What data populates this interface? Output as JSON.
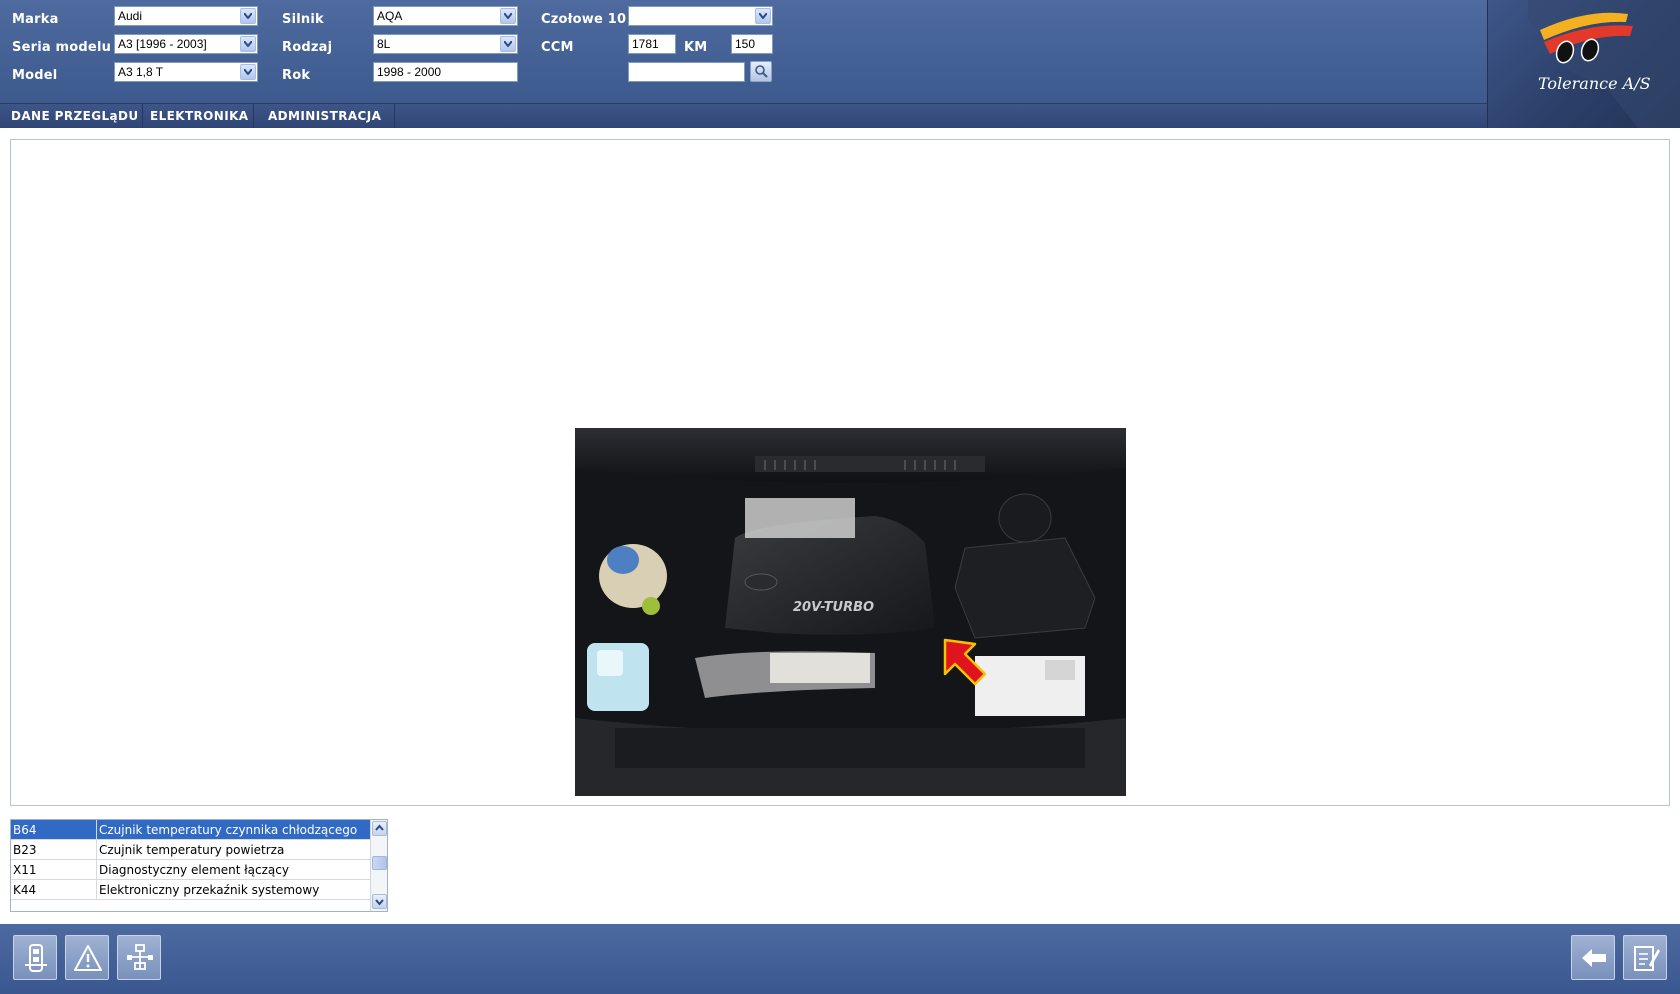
{
  "header": {
    "col1": {
      "make_label": "Marka",
      "make_value": "Audi",
      "series_label": "Seria modelu",
      "series_value": "A3 [1996 - 2003]",
      "model_label": "Model",
      "model_value": "A3 1,8 T"
    },
    "col2": {
      "engine_label": "Silnik",
      "engine_value": "AQA",
      "type_label": "Rodzaj",
      "type_value": "8L",
      "year_label": "Rok",
      "year_value": "1998 - 2000"
    },
    "col3": {
      "top10_label": "Czołowe 10",
      "top10_value": "",
      "ccm_label": "CCM",
      "ccm_value": "1781",
      "km_label": "KM",
      "km_value": "150",
      "search_value": ""
    },
    "logo_text": "Tolerance A/S"
  },
  "menu": {
    "items": [
      "DANE PRZEGLąDU",
      "ELEKTRONIKA",
      "ADMINISTRACJA"
    ]
  },
  "components": {
    "rows": [
      {
        "code": "B64",
        "name": "Czujnik temperatury czynnika chłodzącego"
      },
      {
        "code": "B23",
        "name": "Czujnik temperatury powietrza"
      },
      {
        "code": "X11",
        "name": "Diagnostyczny element łączący"
      },
      {
        "code": "K44",
        "name": "Elektroniczny przekaźnik systemowy"
      }
    ],
    "selected_index": 0
  },
  "photo": {
    "engine_cover_text": "20V-TURBO"
  },
  "colors": {
    "header_bg": "#4e6a9e",
    "menu_bg": "#3e5588",
    "selection": "#316ac5",
    "arrow_marker": "#e0141e"
  },
  "footer": {
    "left_icons": [
      "vehicle-info-icon",
      "warning-icon",
      "wiring-diagram-icon"
    ],
    "right_icons": [
      "back-arrow-icon",
      "edit-document-icon"
    ]
  }
}
